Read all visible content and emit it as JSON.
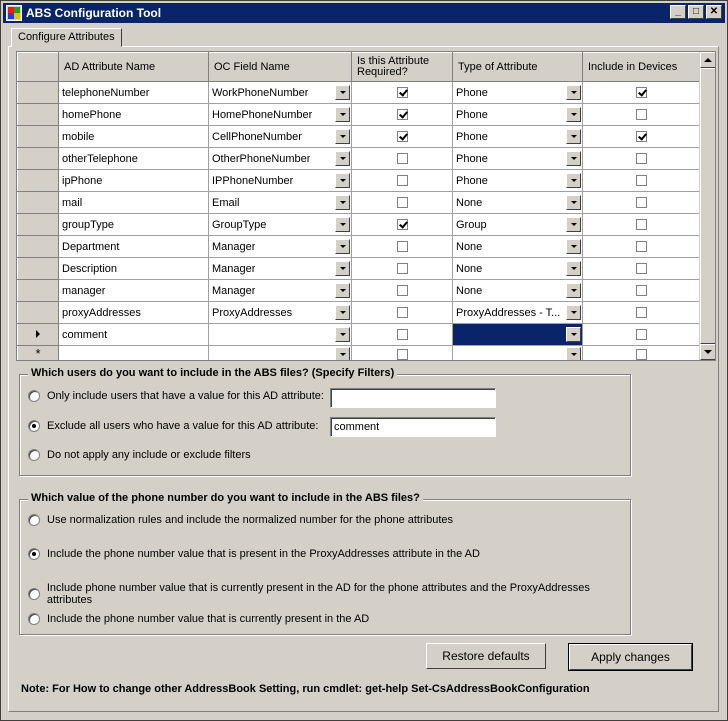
{
  "window": {
    "title": "ABS Configuration Tool"
  },
  "tabs": [
    {
      "label": "Configure Attributes"
    }
  ],
  "grid": {
    "columns": {
      "ad_attribute": "AD Attribute Name",
      "oc_field": "OC Field Name",
      "required": "Is this Attribute Required?",
      "type": "Type of Attribute",
      "include": "Include in Devices"
    },
    "rows": [
      {
        "ad": "telephoneNumber",
        "oc": "WorkPhoneNumber",
        "required": true,
        "type": "Phone",
        "include": true
      },
      {
        "ad": "homePhone",
        "oc": "HomePhoneNumber",
        "required": true,
        "type": "Phone",
        "include": false
      },
      {
        "ad": "mobile",
        "oc": "CellPhoneNumber",
        "required": true,
        "type": "Phone",
        "include": true
      },
      {
        "ad": "otherTelephone",
        "oc": "OtherPhoneNumber",
        "required": false,
        "type": "Phone",
        "include": false
      },
      {
        "ad": "ipPhone",
        "oc": "IPPhoneNumber",
        "required": false,
        "type": "Phone",
        "include": false
      },
      {
        "ad": "mail",
        "oc": "Email",
        "required": false,
        "type": "None",
        "include": false
      },
      {
        "ad": "groupType",
        "oc": "GroupType",
        "required": true,
        "type": "Group",
        "include": false
      },
      {
        "ad": "Department",
        "oc": "Manager",
        "required": false,
        "type": "None",
        "include": false
      },
      {
        "ad": "Description",
        "oc": "Manager",
        "required": false,
        "type": "None",
        "include": false
      },
      {
        "ad": "manager",
        "oc": "Manager",
        "required": false,
        "type": "None",
        "include": false
      },
      {
        "ad": "proxyAddresses",
        "oc": "ProxyAddresses",
        "required": false,
        "type": "ProxyAddresses - T...",
        "include": false
      },
      {
        "ad": "comment",
        "oc": "",
        "required": false,
        "type": "",
        "include": false,
        "current": true
      },
      {
        "ad": "",
        "oc": "",
        "required": false,
        "type": "",
        "include": false,
        "new_row": true
      }
    ]
  },
  "filters": {
    "title": "Which users do you want to include in the ABS files? (Specify Filters)",
    "only_include_label": "Only include users that have a value for this AD attribute:",
    "only_include_value": "",
    "exclude_label": "Exclude all users who have a value for this AD attribute:",
    "exclude_value": "comment",
    "no_filter_label": "Do not apply any include or exclude filters",
    "selected": "exclude"
  },
  "phone": {
    "title": "Which value of the phone number do you want to include in the ABS files?",
    "opt1": "Use normalization rules and include the normalized number for the phone attributes",
    "opt2": "Include the phone number value that is present in the ProxyAddresses attribute in the AD",
    "opt3": "Include phone number value that is currently present in the AD for the phone attributes and the ProxyAddresses attributes",
    "opt4": "Include the phone number value that is currently present in the AD",
    "selected": "opt2"
  },
  "buttons": {
    "restore": "Restore defaults",
    "apply": "Apply changes"
  },
  "note": "Note: For How to change  other AddressBook  Setting, run cmdlet: get-help Set-CsAddressBookConfiguration"
}
